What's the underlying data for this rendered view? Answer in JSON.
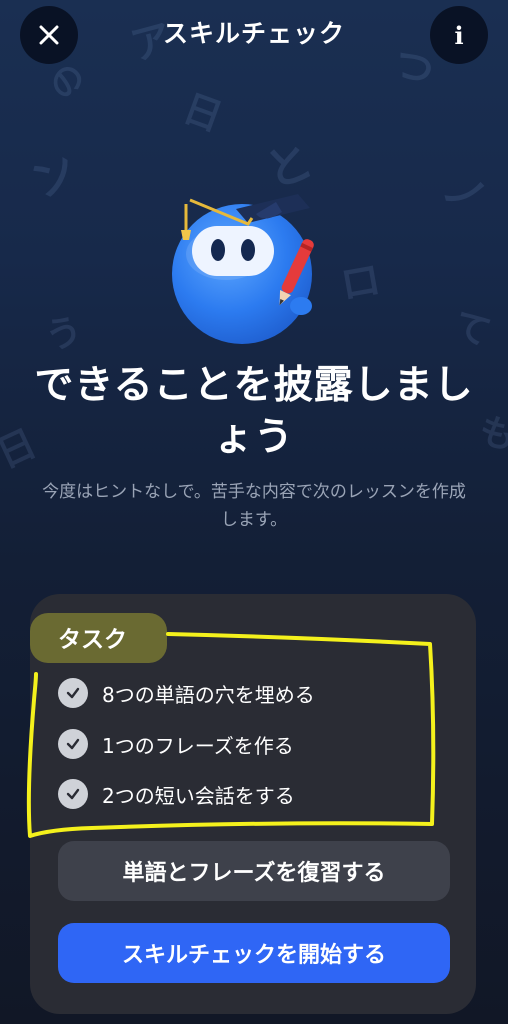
{
  "header": {
    "title": "スキルチェック",
    "close_icon": "close-icon",
    "info_icon": "info-icon"
  },
  "hero": {
    "title": "できることを披露しましょう",
    "subtitle": "今度はヒントなしで。苦手な内容で次のレッスンを作成します。"
  },
  "tasks": {
    "label": "タスク",
    "items": [
      {
        "text": "8つの単語の穴を埋める"
      },
      {
        "text": "1つのフレーズを作る"
      },
      {
        "text": "2つの短い会話をする"
      }
    ]
  },
  "buttons": {
    "review": "単語とフレーズを復習する",
    "start": "スキルチェックを開始する"
  },
  "colors": {
    "accent": "#2f66f5",
    "panel": "#2a2c34",
    "highlight": "#6a6a32",
    "annotation": "#f4f11c"
  }
}
